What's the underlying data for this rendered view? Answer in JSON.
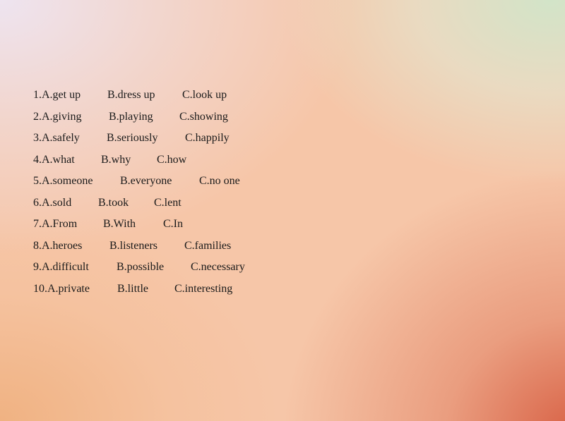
{
  "questions": [
    {
      "A": "1.A.get up",
      "B": "B.dress up",
      "C": "C.look up"
    },
    {
      "A": "2.A.giving",
      "B": "B.playing",
      "C": "C.showing"
    },
    {
      "A": "3.A.safely",
      "B": "B.seriously",
      "C": "C.happily"
    },
    {
      "A": "4.A.what",
      "B": "B.why",
      "C": "C.how"
    },
    {
      "A": "5.A.someone",
      "B": "B.everyone",
      "C": "C.no one"
    },
    {
      "A": "6.A.sold",
      "B": "B.took",
      "C": "C.lent"
    },
    {
      "A": "7.A.From",
      "B": "B.With",
      "C": "C.In"
    },
    {
      "A": "8.A.heroes",
      "B": "B.listeners",
      "C": "C.families"
    },
    {
      "A": "9.A.difficult",
      "B": "B.possible",
      "C": "C.necessary"
    },
    {
      "A": "10.A.private",
      "B": "B.little",
      "C": "C.interesting"
    }
  ]
}
